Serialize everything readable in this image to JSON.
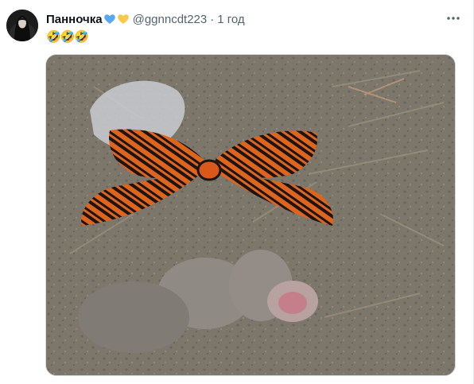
{
  "tweet": {
    "display_name": "Панночка",
    "heart_colors": [
      "#5aa9f0",
      "#f7c948"
    ],
    "handle": "@ggnncdt223",
    "separator": "·",
    "time": "1 год",
    "text": "🤣🤣🤣"
  },
  "icons": {
    "more": "more-dots-icon",
    "hearts": [
      "blue-heart-icon",
      "yellow-heart-icon"
    ]
  },
  "colors": {
    "name": "#0f1419",
    "meta": "#536471",
    "border": "#cfd9de",
    "ribbon_orange": "#e0651c",
    "ribbon_black": "#1b1410"
  }
}
